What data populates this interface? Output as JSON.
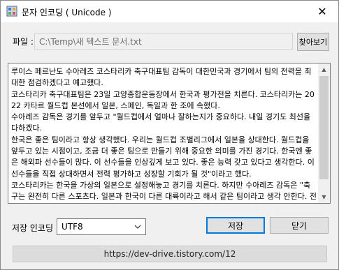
{
  "window": {
    "title": "문자 인코딩 ( Unicode )",
    "close_glyph": "✕"
  },
  "file": {
    "label": "파일 :",
    "path": "C:\\Temp\\새 텍스트 문서.txt",
    "browse_label": "찾아보기"
  },
  "editor": {
    "text": "루이스 페르난도 수아레즈 코스타리카 축구대표팀 감독이 대한민국과 경기에서 팀의 전력을 최대한 점검하겠다고 예고했다.\n코스타리카 축구대표팀은 23일 고양종합운동장에서 한국과 평가전을 치른다. 코스타리카는 2022 카타르 월드컵 본선에서 일본, 스페인, 독일과 한 조에 속했다.\n수아레즈 감독은 경기를 앞두고 \"월드컵에서 얼마나 잘하는지가 중요하다. 내일 경기도 최선을 다하겠다.\n한국은 좋은 팀이라고 항상 생각했다. 우리는 월드컵 조별리그에서 일본을 상대한다. 월드컵을 앞두고 있는 시점이고, 조금 더 좋은 팀으로 만들기 위해 중요한 의미를 가진 경기다. 한국엔 좋은 해외파 선수들이 많다. 이 선수들을 인상깊게 보고 있다. 좋은 능력 갖고 있다고 생각한다. 이 선수들을 직접 상대하면서 전력 평가하고 성장할 기회가 될 것\"이라고 했다.\n코스타리카는 한국을 가상의 일본으로 설정해놓고 경기를 치른다. 하지만 수아레즈 감독은 \"축구는 완전히 다른 스포츠다. 일본과 한국이 다른 대륙이라고 해서 같은 팀이라고 생각 안한다. 전술, 선수 다르다. 완전히 다른 팀이다. 한국과 일본을 비슷한 팀이라고 생각하는 건 한국팀에 대한 예의가 아니다. 우리팀이 평가전 경기 운영이 중요하다. 조수가 선수 경기운영을 점검하는"
  },
  "encoding": {
    "label": "저장 인코딩 :",
    "selected": "UTF8"
  },
  "actions": {
    "save_label": "저장",
    "close_label": "닫기"
  },
  "footer": {
    "url": "https://dev-drive.tistory.com/12"
  }
}
